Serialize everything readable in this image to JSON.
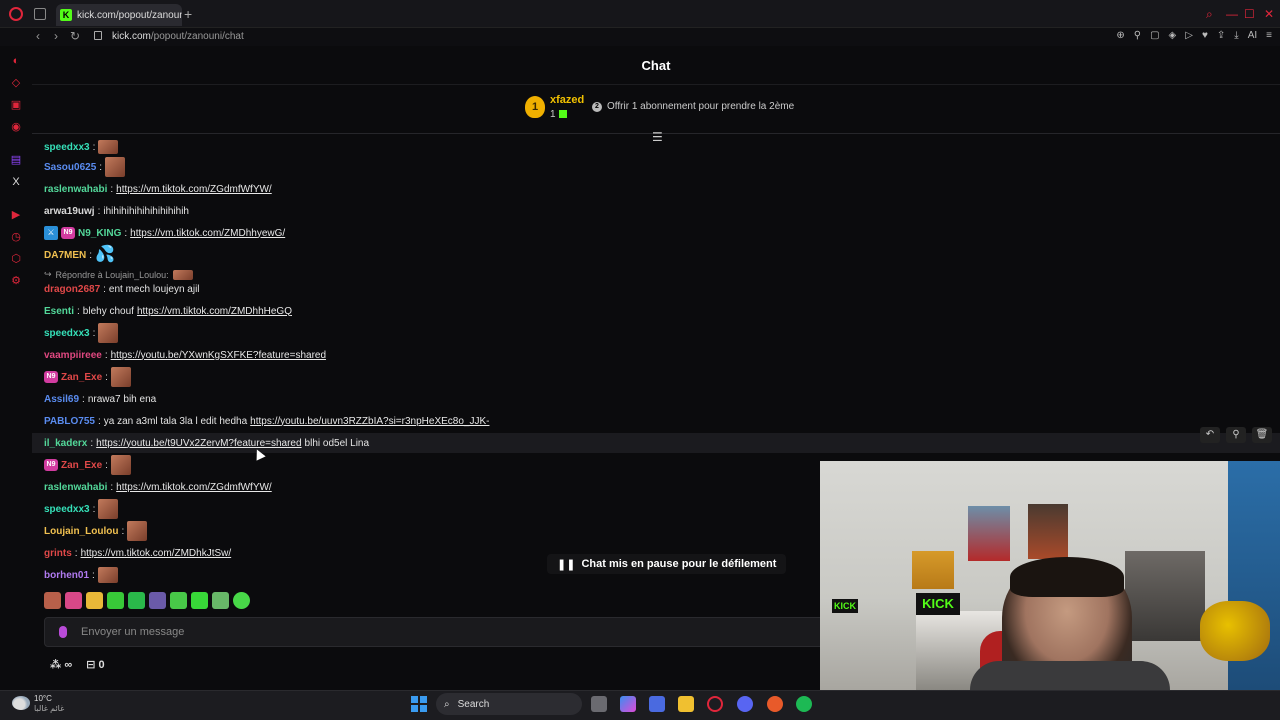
{
  "browser": {
    "tab_title": "kick.com/popout/zanouni/",
    "url_host": "kick.com",
    "url_path": "/popout/zanouni/chat",
    "ai_label": "AI"
  },
  "chat": {
    "title": "Chat",
    "gifter": {
      "rank": "1",
      "name": "xfazed",
      "count": "1"
    },
    "gift_offer": "Offrir 1 abonnement pour prendre la 2ème",
    "reply_to": "Répondre à Loujain_Loulou:",
    "messages": [
      {
        "user": "speedxx3",
        "color": "#35e0b8",
        "text": "",
        "link": "",
        "emote": true
      },
      {
        "user": "Sasou0625",
        "color": "#5a8cf0",
        "text": "",
        "link": "",
        "emote": true
      },
      {
        "user": "raslenwahabi",
        "color": "#53d89a",
        "text": "",
        "link": "https://vm.tiktok.com/ZGdmfWfYW/",
        "emote": false
      },
      {
        "user": "arwa19uwj",
        "color": "#d8d8d8",
        "text": "ihihihihihihihihihihih",
        "link": "",
        "emote": false
      },
      {
        "user": "N9_KING",
        "color": "#53d89a",
        "text": "",
        "link": "https://vm.tiktok.com/ZMDhhyewG/",
        "emote": false
      },
      {
        "user": "DA7MEN",
        "color": "#f0c050",
        "text": "",
        "link": "",
        "emote": false
      },
      {
        "user": "dragon2687",
        "color": "#e04848",
        "text": "ent mech loujeyn ajil",
        "link": "",
        "emote": false
      },
      {
        "user": "Esenti",
        "color": "#53d89a",
        "text": "blehy chouf",
        "link": "https://vm.tiktok.com/ZMDhhHeGQ",
        "emote": false
      },
      {
        "user": "speedxx3",
        "color": "#35e0b8",
        "text": "",
        "link": "",
        "emote": true
      },
      {
        "user": "vaampiireee",
        "color": "#e04880",
        "text": "",
        "link": "https://youtu.be/YXwnKgSXFKE?feature=shared",
        "emote": false
      },
      {
        "user": "Zan_Exe",
        "color": "#e04848",
        "text": "",
        "link": "",
        "emote": true
      },
      {
        "user": "Assil69",
        "color": "#5a8cf0",
        "text": "nrawa7 bih ena",
        "link": "",
        "emote": false
      },
      {
        "user": "PABLO755",
        "color": "#5a8cf0",
        "text": "ya zan a3ml tala 3la l edit hedha",
        "link": "https://youtu.be/uuvn3RZZbIA?si=r3npHeXEc8o_JJK-",
        "emote": false
      },
      {
        "user": "il_kaderx",
        "color": "#53d89a",
        "text": "blhi od5el Lina",
        "link": "https://youtu.be/t9UVx2ZervM?feature=shared",
        "emote": false
      },
      {
        "user": "Zan_Exe",
        "color": "#e04848",
        "text": "",
        "link": "",
        "emote": true
      },
      {
        "user": "raslenwahabi",
        "color": "#53d89a",
        "text": "",
        "link": "https://vm.tiktok.com/ZGdmfWfYW/",
        "emote": false
      },
      {
        "user": "speedxx3",
        "color": "#35e0b8",
        "text": "",
        "link": "",
        "emote": true
      },
      {
        "user": "Loujain_Loulou",
        "color": "#f0c050",
        "text": "",
        "link": "",
        "emote": true
      },
      {
        "user": "grints",
        "color": "#e04848",
        "text": "",
        "link": "https://vm.tiktok.com/ZMDhkJtSw/",
        "emote": false
      },
      {
        "user": "borhen01",
        "color": "#b07af0",
        "text": "",
        "link": "",
        "emote": true
      }
    ],
    "paused_notice": "Chat mis en pause pour le défilement",
    "input_placeholder": "Envoyer un message",
    "points_value": "∞",
    "store_count": "0"
  },
  "webcam": {
    "kick_sign": "KICK",
    "kick_sign_small": "KICK"
  },
  "taskbar": {
    "temperature": "10°C",
    "weather_desc": "غائم غالبا",
    "search_label": "Search"
  }
}
